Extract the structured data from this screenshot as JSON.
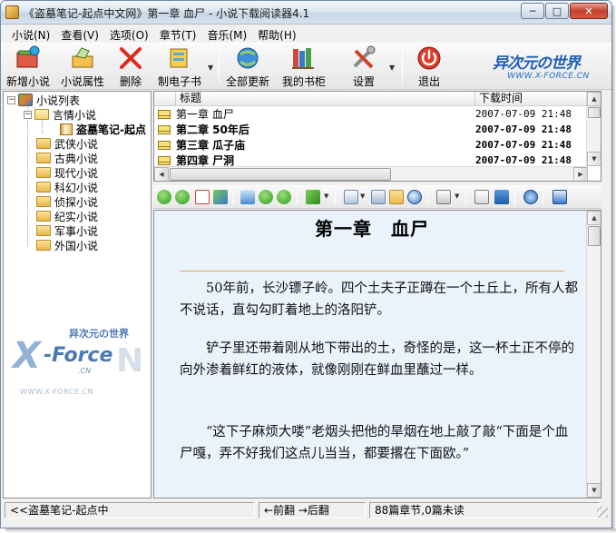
{
  "window": {
    "title": "《盗墓笔记-起点中文网》第一章 血尸 - 小说下载阅读器4.1",
    "buttons": {
      "minimize": "─",
      "maximize": "□",
      "close": "✕"
    }
  },
  "menu": [
    {
      "label": "小说(N)",
      "name": "menu-novel"
    },
    {
      "label": "查看(V)",
      "name": "menu-view"
    },
    {
      "label": "选项(O)",
      "name": "menu-options"
    },
    {
      "label": "章节(T)",
      "name": "menu-chapter"
    },
    {
      "label": "音乐(M)",
      "name": "menu-music"
    },
    {
      "label": "帮助(H)",
      "name": "menu-help"
    }
  ],
  "toolbar": {
    "add_novel": "新增小说",
    "properties": "小说属性",
    "delete": "删除",
    "make_ebook": "制电子书",
    "update_all": "全部更新",
    "bookshelf": "我的书柜",
    "settings": "设置",
    "exit": "退出"
  },
  "logo": {
    "top": "异次元の世界",
    "bottom": "WWW.X-FORCE.CN"
  },
  "tree": {
    "root": "小说列表",
    "open_category": "言情小说",
    "open_book": "盗墓笔记-起点",
    "categories": [
      "武侠小说",
      "古典小说",
      "现代小说",
      "科幻小说",
      "侦探小说",
      "纪实小说",
      "军事小说",
      "外国小说"
    ]
  },
  "watermark": {
    "x": "X",
    "force": "-Force",
    "top": "异次元の世界",
    "n": "N",
    "cn": ".CN",
    "url": "WWW.X-FORCE.CN"
  },
  "chapter_list": {
    "columns": [
      "标题",
      "下载时间"
    ],
    "rows": [
      {
        "title": "第一章 血尸",
        "time": "2007-07-09 21:48",
        "bold": false
      },
      {
        "title": "第二章 50年后",
        "time": "2007-07-09 21:48",
        "bold": true
      },
      {
        "title": "第三章 瓜子庙",
        "time": "2007-07-09 21:48",
        "bold": true
      },
      {
        "title": "第四章 尸洞",
        "time": "2007-07-09 21:48",
        "bold": true
      }
    ]
  },
  "reader": {
    "title": "第一章　血尸",
    "paragraphs": [
      "　　50年前，长沙镖子岭。四个土夫子正蹲在一个土丘上，所有人都不说话，直勾勾盯着地上的洛阳铲。",
      "　　铲子里还带着刚从地下带出的土，奇怪的是，这一杯土正不停的向外渗着鲜红的液体，就像刚刚在鲜血里蘸过一样。",
      "　　“这下子麻烦大喽”老烟头把他的旱烟在地上敲了敲“下面是个血尸嘎，弄不好我们这点儿当当，都要撂在下面欧。”"
    ]
  },
  "status": {
    "current": "<<盗墓笔记-起点中",
    "nav": "←前翻 →后翻",
    "count": "88篇章节,0篇未读"
  },
  "colors": {
    "reader_bg": "#eaf2fb",
    "rule": "#d9a95f",
    "logo_blue": "#1d5fb3"
  }
}
